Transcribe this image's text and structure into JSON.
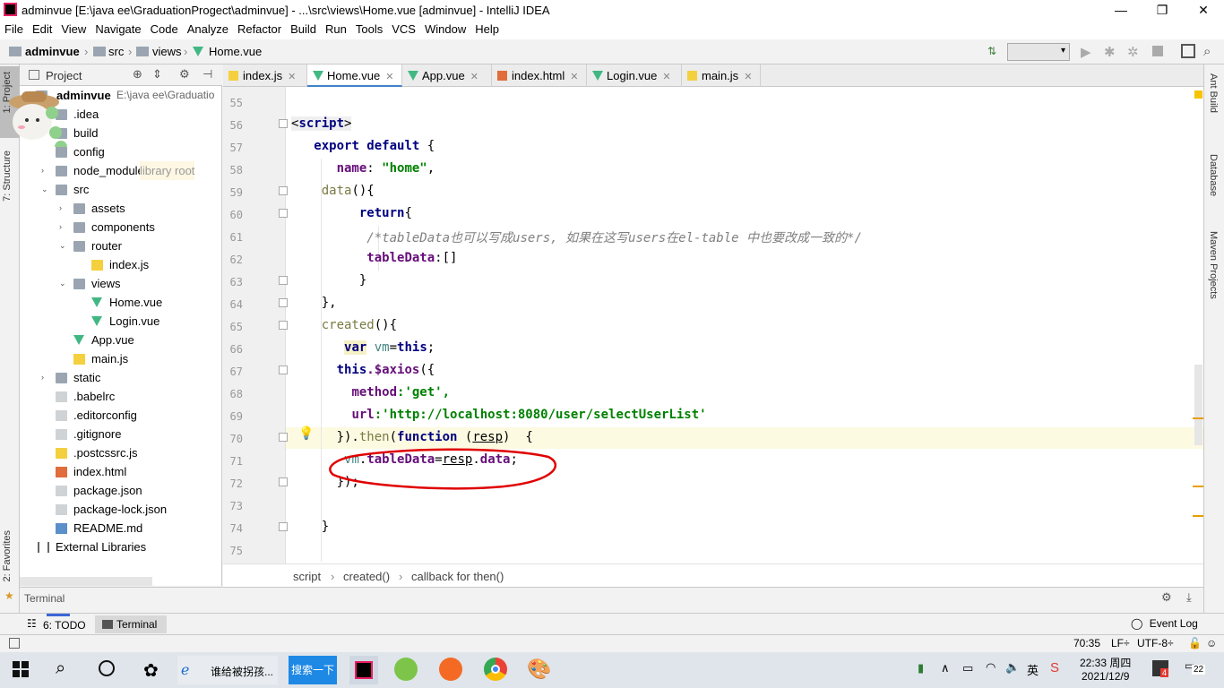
{
  "window": {
    "title": "adminvue [E:\\java ee\\GraduationProgect\\adminvue] - ...\\src\\views\\Home.vue [adminvue] - IntelliJ IDEA",
    "app_icon": "intellij-icon"
  },
  "menu": [
    "File",
    "Edit",
    "View",
    "Navigate",
    "Code",
    "Analyze",
    "Refactor",
    "Build",
    "Run",
    "Tools",
    "VCS",
    "Window",
    "Help"
  ],
  "breadcrumb": [
    "adminvue",
    "src",
    "views",
    "Home.vue"
  ],
  "sidebar_left": {
    "project_tab": "1: Project",
    "structure_tab": "7: Structure",
    "favorites_tab": "2: Favorites"
  },
  "project_panel": {
    "title": "Project",
    "root_name": "adminvue",
    "root_path": "E:\\java ee\\Graduatio",
    "items": [
      {
        "label": ".idea",
        "depth": 1,
        "kind": "folder",
        "arrow": "",
        "note": ""
      },
      {
        "label": "build",
        "depth": 1,
        "kind": "folder",
        "arrow": "",
        "note": ""
      },
      {
        "label": "config",
        "depth": 1,
        "kind": "folder",
        "arrow": "",
        "note": ""
      },
      {
        "label": "node_modules",
        "depth": 1,
        "kind": "folder",
        "arrow": "›",
        "note": "library root"
      },
      {
        "label": "src",
        "depth": 1,
        "kind": "folder",
        "arrow": "⌄",
        "note": ""
      },
      {
        "label": "assets",
        "depth": 2,
        "kind": "folder",
        "arrow": "›",
        "note": ""
      },
      {
        "label": "components",
        "depth": 2,
        "kind": "folder",
        "arrow": "›",
        "note": ""
      },
      {
        "label": "router",
        "depth": 2,
        "kind": "folder",
        "arrow": "⌄",
        "note": ""
      },
      {
        "label": "index.js",
        "depth": 3,
        "kind": "js",
        "arrow": "",
        "note": ""
      },
      {
        "label": "views",
        "depth": 2,
        "kind": "folder",
        "arrow": "⌄",
        "note": ""
      },
      {
        "label": "Home.vue",
        "depth": 3,
        "kind": "vue",
        "arrow": "",
        "note": ""
      },
      {
        "label": "Login.vue",
        "depth": 3,
        "kind": "vue",
        "arrow": "",
        "note": ""
      },
      {
        "label": "App.vue",
        "depth": 2,
        "kind": "vue",
        "arrow": "",
        "note": ""
      },
      {
        "label": "main.js",
        "depth": 2,
        "kind": "js",
        "arrow": "",
        "note": ""
      },
      {
        "label": "static",
        "depth": 1,
        "kind": "folder",
        "arrow": "›",
        "note": ""
      },
      {
        "label": ".babelrc",
        "depth": 1,
        "kind": "cfg",
        "arrow": "",
        "note": ""
      },
      {
        "label": ".editorconfig",
        "depth": 1,
        "kind": "cfg",
        "arrow": "",
        "note": ""
      },
      {
        "label": ".gitignore",
        "depth": 1,
        "kind": "cfg",
        "arrow": "",
        "note": ""
      },
      {
        "label": ".postcssrc.js",
        "depth": 1,
        "kind": "js",
        "arrow": "",
        "note": ""
      },
      {
        "label": "index.html",
        "depth": 1,
        "kind": "html",
        "arrow": "",
        "note": ""
      },
      {
        "label": "package.json",
        "depth": 1,
        "kind": "cfg",
        "arrow": "",
        "note": ""
      },
      {
        "label": "package-lock.json",
        "depth": 1,
        "kind": "cfg",
        "arrow": "",
        "note": ""
      },
      {
        "label": "README.md",
        "depth": 1,
        "kind": "md",
        "arrow": "",
        "note": ""
      },
      {
        "label": "External Libraries",
        "depth": 0,
        "kind": "lib",
        "arrow": "",
        "note": ""
      }
    ]
  },
  "tabs": [
    {
      "label": "index.js",
      "icon": "js-file-icon",
      "active": false
    },
    {
      "label": "Home.vue",
      "icon": "vue-file-icon",
      "active": true
    },
    {
      "label": "App.vue",
      "icon": "vue-file-icon",
      "active": false
    },
    {
      "label": "index.html",
      "icon": "html-file-icon",
      "active": false
    },
    {
      "label": "Login.vue",
      "icon": "vue-file-icon",
      "active": false
    },
    {
      "label": "main.js",
      "icon": "js-file-icon",
      "active": false
    }
  ],
  "editor": {
    "lines": [
      55,
      56,
      57,
      58,
      59,
      60,
      61,
      62,
      63,
      64,
      65,
      66,
      67,
      68,
      69,
      70,
      71,
      72,
      73,
      74,
      75
    ],
    "current_line": 70,
    "annotation_color": "#e00000"
  },
  "code_text": {
    "l56_tag": "script",
    "l57_export": "export default",
    "l57_rest": " {",
    "l58_name": "name",
    "l58_val": "\"home\"",
    "l59_data": "data",
    "l59_rest": "(){",
    "l60_return": "return",
    "l60_rest": "{",
    "l61_comment": "/*tableData也可以写成users, 如果在这写users在el-table 中也要改成一致的*/",
    "l62_key": "tableData",
    "l62_val": ":[]",
    "l63": "}",
    "l64": "},",
    "l65_created": "created",
    "l65_rest": "(){",
    "l66_var": "var",
    "l66_vm": "vm",
    "l66_eq": "=",
    "l66_this": "this",
    "l66_end": ";",
    "l67_this": "this",
    "l67_axios": ".$axios",
    "l67_rest": "({",
    "l68_key": "method",
    "l68_val": ":'get',",
    "l69_key": "url",
    "l69_val": ":'http://localhost:8080/user/selectUserList'",
    "l70_a": "}).",
    "l70_then": "then",
    "l70_b": "(",
    "l70_function": "function",
    "l70_c": " (",
    "l70_resp": "resp",
    "l70_d": ")  {",
    "l71_vm": "vm",
    "l71_a": ".",
    "l71_td": "tableData",
    "l71_eq": "=",
    "l71_resp": "resp",
    "l71_b": ".",
    "l71_data": "data",
    "l71_end": ";",
    "l72": "});",
    "l74": "}"
  },
  "editor_breadcrumb": [
    "script",
    "created()",
    "callback for then()"
  ],
  "right_tools": [
    "Ant Build",
    "Database",
    "Maven Projects"
  ],
  "terminal_label": "Terminal",
  "bottom_tabs": [
    {
      "label": "6: TODO",
      "icon": "todo-icon"
    },
    {
      "label": "Terminal",
      "icon": "terminal-icon"
    }
  ],
  "event_log": "Event Log",
  "status": {
    "position": "70:35",
    "line_sep": "LF÷",
    "encoding": "UTF-8÷"
  },
  "taskbar": {
    "search_text": "谁给被拐孩...",
    "search_button": "搜索一下",
    "time": "22:33 周四",
    "date": "2021/12/9",
    "ime": "英",
    "notif_count": "22",
    "badge": "4"
  }
}
